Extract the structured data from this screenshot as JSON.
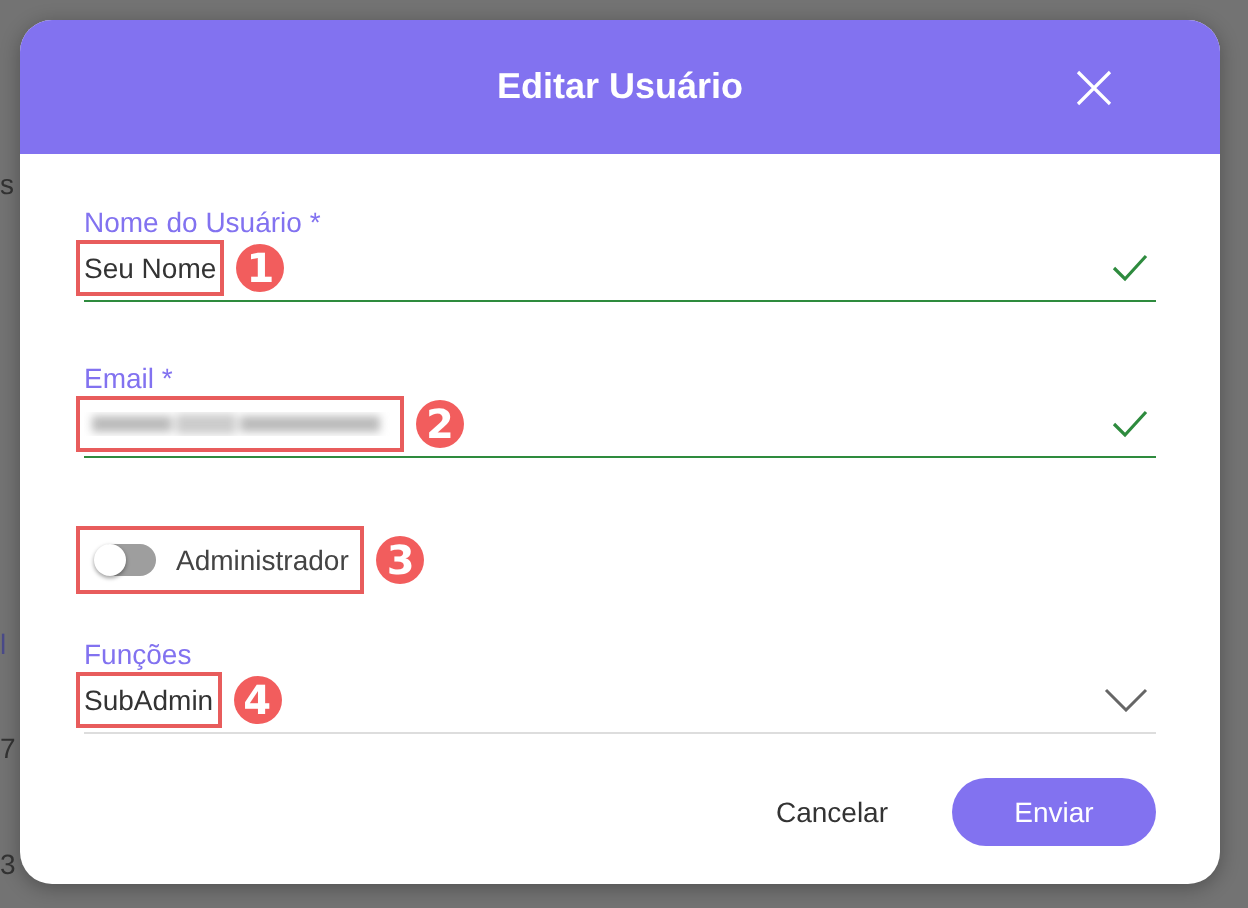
{
  "backdrop_texts": [
    {
      "text": "s"
    },
    {
      "text": "l"
    },
    {
      "text": "7"
    },
    {
      "text": "3"
    }
  ],
  "dialog": {
    "title": "Editar Usuário",
    "fields": [
      {
        "kind": "text",
        "label": "Nome do Usuário *",
        "value": "Seu Nome",
        "valid": true,
        "callout": "1"
      },
      {
        "kind": "redacted",
        "label": "Email *",
        "valid": true,
        "callout": "2"
      },
      {
        "kind": "toggle",
        "label": "Administrador",
        "on": false,
        "callout": "3"
      },
      {
        "kind": "select",
        "label": "Funções",
        "value": "SubAdmin",
        "callout": "4"
      }
    ],
    "buttons": [
      {
        "kind": "text",
        "label": "Cancelar"
      },
      {
        "kind": "primary",
        "label": "Enviar"
      }
    ]
  }
}
